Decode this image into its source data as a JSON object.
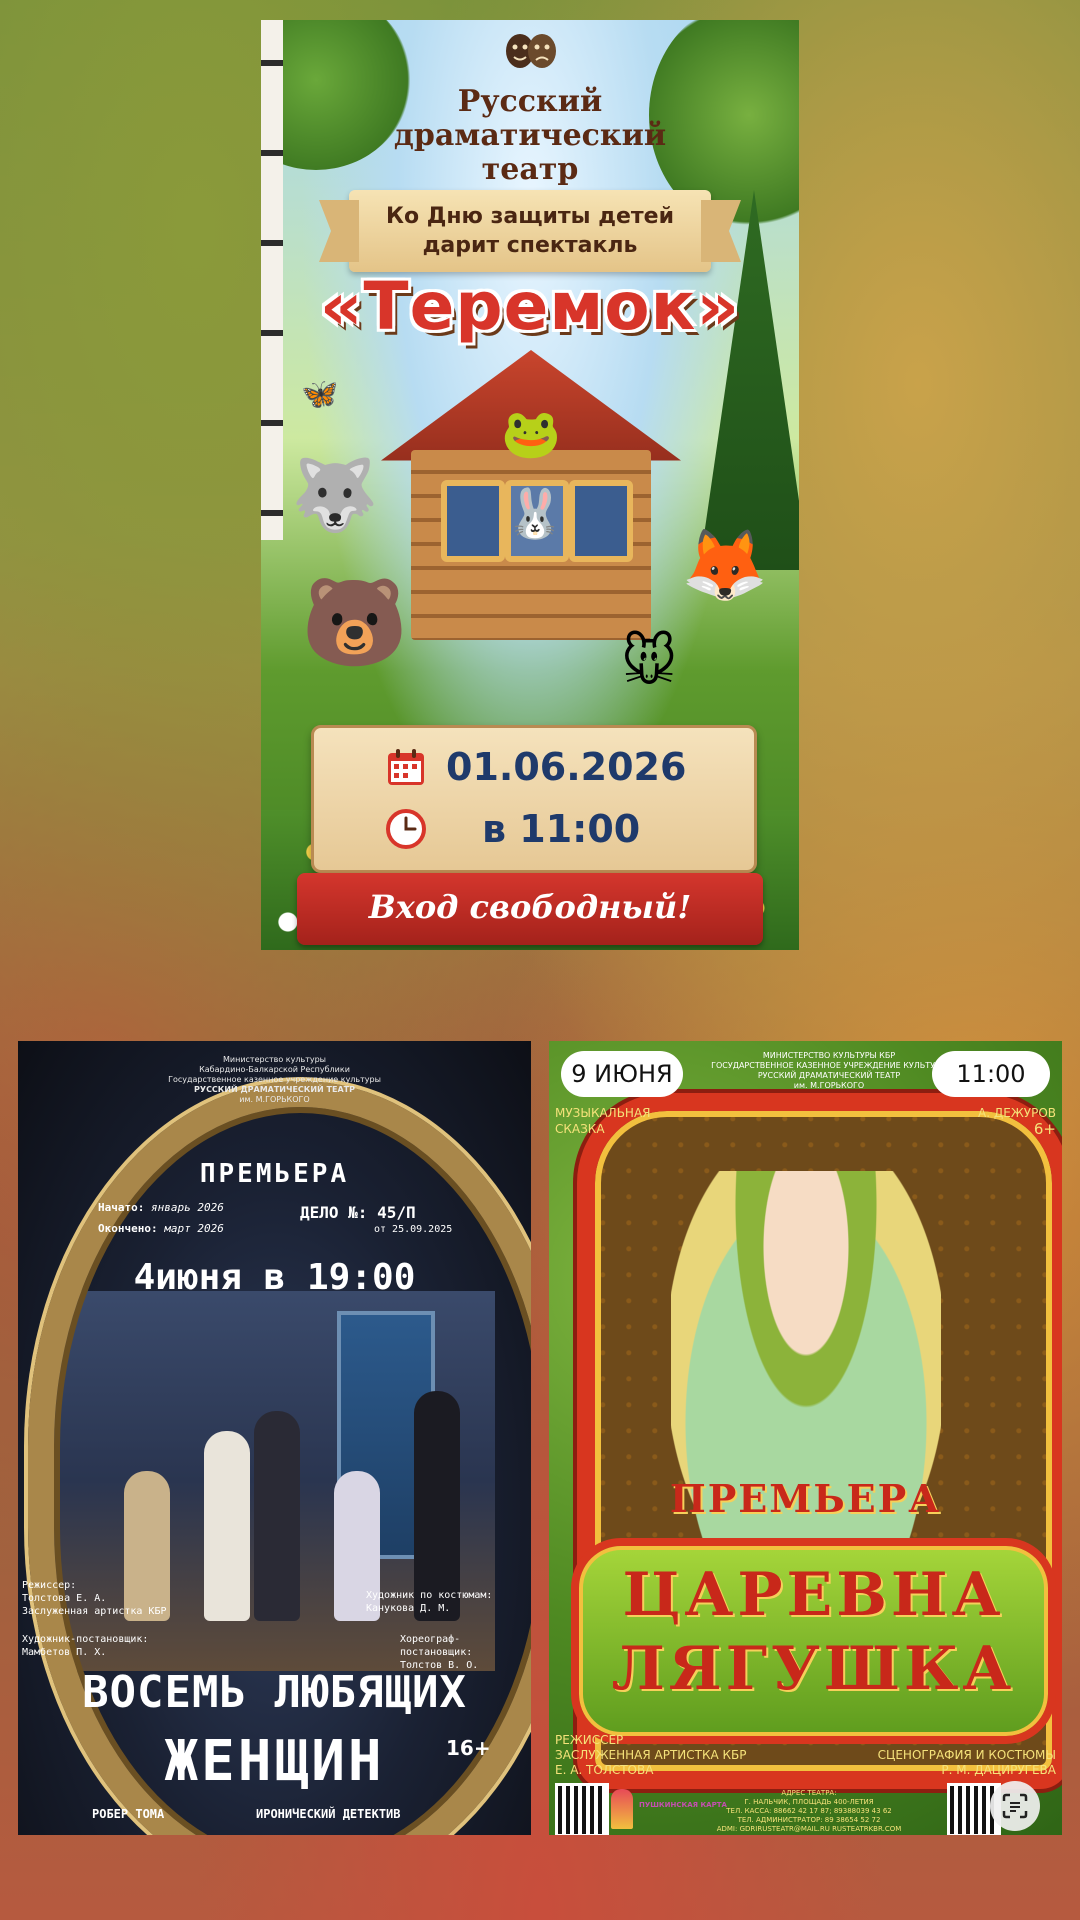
{
  "poster_teremok": {
    "theatre_line1": "Русский",
    "theatre_line2": "драматический",
    "theatre_line3": "театр",
    "occasion_line1": "Ко Дню защиты детей",
    "occasion_line2": "дарит спектакль",
    "title": "«Теремок»",
    "date": "01.06.2026",
    "time": "в 11:00",
    "entry": "Вход свободный!",
    "icons": [
      "theatre-masks-icon",
      "calendar-icon",
      "clock-icon"
    ]
  },
  "poster_women": {
    "header_line1": "Министерство культуры",
    "header_line2": "Кабардино-Балкарской Республики",
    "header_line3": "Государственное казенное учреждение культуры",
    "header_line4": "РУССКИЙ ДРАМАТИЧЕСКИЙ ТЕАТР",
    "header_line5": "им. М.ГОРЬКОГО",
    "premiere": "ПРЕМЬЕРА",
    "started_label": "Начато:",
    "started_value": "январь 2026",
    "ended_label": "Окончено:",
    "ended_value": "март 2026",
    "case": "ДЕЛО №: 45/П",
    "case_date": "от 25.09.2025",
    "datetime": "4июня в 19:00",
    "director_role": "Режиссер:",
    "director_name": "Толстова Е. А.",
    "director_title": "Заслуженная артистка КБР",
    "costume_role": "Художник по костюмам:",
    "costume_name": "Канукова Д. М.",
    "designer_role": "Художник-постановщик:",
    "designer_name": "Мамбетов П. Х.",
    "choreo_role": "Хореограф-постановщик:",
    "choreo_name": "Толстов В. О.",
    "title_line1": "ВОСЕМЬ ЛЮБЯЩИХ",
    "title_line2": "ЖЕНЩИН",
    "age": "16+",
    "author": "РОБЕР ТОМА",
    "genre": "ИРОНИЧЕСКИЙ ДЕТЕКТИВ"
  },
  "poster_frog": {
    "date": "9 ИЮНЯ",
    "time": "11:00",
    "header_line1": "МИНИСТЕРСТВО КУЛЬТУРЫ КБР",
    "header_line2": "ГОСУДАРСТВЕННОЕ КАЗЕННОЕ УЧРЕЖДЕНИЕ КУЛЬТУРЫ",
    "header_line3": "РУССКИЙ ДРАМАТИЧЕСКИЙ ТЕАТР",
    "header_line4": "им. М.ГОРЬКОГО",
    "genre_line1": "МУЗЫКАЛЬНАЯ",
    "genre_line2": "СКАЗКА",
    "author": "А. ДЕЖУРОВ",
    "age": "6+",
    "premiere": "ПРЕМЬЕРА",
    "title_line1": "ЦАРЕВНА",
    "title_line2": "ЛЯГУШКА",
    "director_role": "РЕЖИССЕР",
    "director_title": "ЗАСЛУЖЕННАЯ АРТИСТКА КБР",
    "director_name": "Е. А. ТОЛСТОВА",
    "design_role": "СЦЕНОГРАФИЯ И КОСТЮМЫ",
    "design_name": "Р. М. ДАЦИРУГЕВА",
    "address_line1": "АДРЕС ТЕАТРА:",
    "address_line2": "Г. НАЛЬЧИК, ПЛОЩАДЬ 400-ЛЕТИЯ",
    "address_line3": "ТЕЛ. КАССА: 88662 42 17 87; 89388039 43 62",
    "address_line4": "ТЕЛ. АДМИНИСТРАТОР: 89 38654 52 72",
    "address_line5": "ADMI: GDRIRUSTEATR@MAIL.RU   RUSTEATRKBR.COM",
    "card_label": "ПУШКИНСКАЯ КАРТА",
    "lens_icon": "google-lens-icon"
  }
}
